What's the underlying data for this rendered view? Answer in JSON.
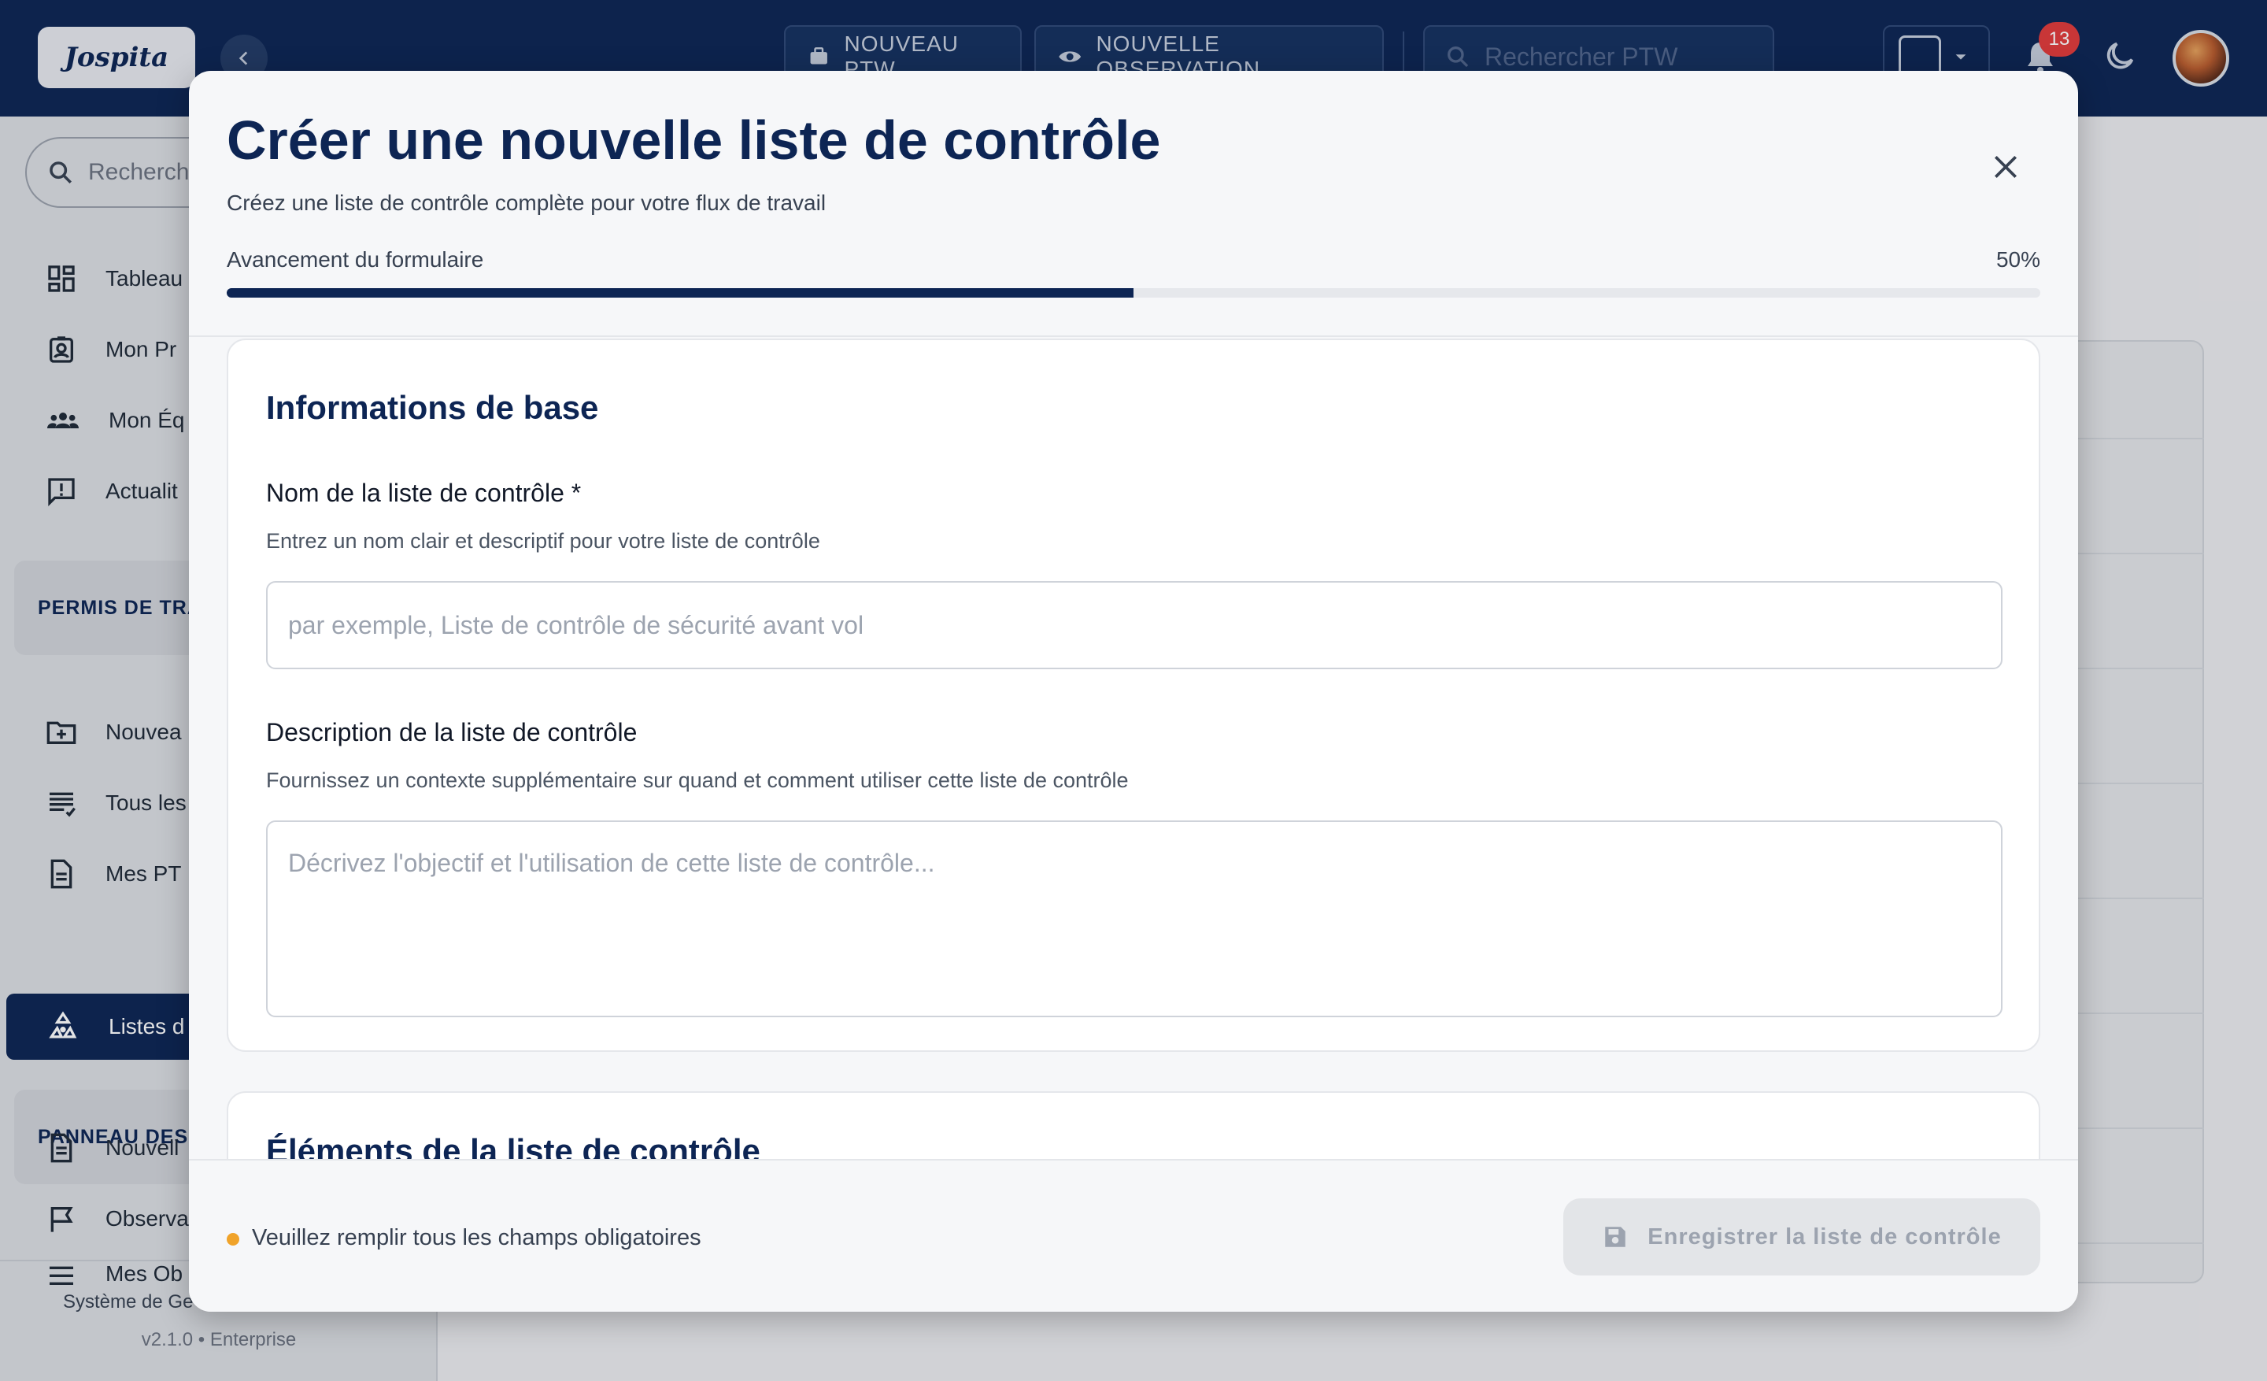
{
  "app": {
    "logo_text": "Jospita"
  },
  "topbar": {
    "new_ptw": "NOUVEAU PTW",
    "new_observation": "NOUVELLE OBSERVATION",
    "search_placeholder": "Rechercher PTW",
    "notification_count": "13"
  },
  "sidebar": {
    "search_placeholder": "Recherch",
    "items_top": [
      {
        "label": "Tableau",
        "icon": "dashboard-icon"
      },
      {
        "label": "Mon Pr",
        "icon": "profile-badge-icon"
      },
      {
        "label": "Mon Éq",
        "icon": "team-icon"
      },
      {
        "label": "Actualit",
        "icon": "announcement-icon"
      }
    ],
    "section_permits": "PERMIS DE TRA",
    "items_permits": [
      {
        "label": "Nouvea",
        "icon": "folder-plus-icon"
      },
      {
        "label": "Tous les",
        "icon": "list-icon"
      },
      {
        "label": "Mes PT",
        "icon": "document-icon"
      },
      {
        "label": "Listes d",
        "icon": "recycle-icon",
        "active": true
      }
    ],
    "section_panel": "PANNEAU DES",
    "items_panel": [
      {
        "label": "Nouvell",
        "icon": "document-icon"
      },
      {
        "label": "Observa",
        "icon": "flag-icon"
      },
      {
        "label": "Mes Ob",
        "icon": "menu-icon"
      }
    ],
    "footer_line1": "Système de Ge",
    "footer_line2": "v2.1.0 • Enterprise"
  },
  "modal": {
    "title": "Créer une nouvelle liste de contrôle",
    "subtitle": "Créez une liste de contrôle complète pour votre flux de travail",
    "progress_label": "Avancement du formulaire",
    "progress_text": "50%",
    "progress_value": 0.5,
    "section_basic": "Informations de base",
    "name_label": "Nom de la liste de contrôle *",
    "name_help": "Entrez un nom clair et descriptif pour votre liste de contrôle",
    "name_placeholder": "par exemple, Liste de contrôle de sécurité avant vol",
    "name_value": "",
    "desc_label": "Description de la liste de contrôle",
    "desc_help": "Fournissez un contexte supplémentaire sur quand et comment utiliser cette liste de contrôle",
    "desc_placeholder": "Décrivez l'objectif et l'utilisation de cette liste de contrôle...",
    "desc_value": "",
    "section_items": "Éléments de la liste de contrôle",
    "warning": "Veuillez remplir tous les champs obligatoires",
    "save_label": "Enregistrer la liste de contrôle"
  },
  "colors": {
    "navy": "#0d2554",
    "warning": "#f0a32a",
    "badge": "#e23b3b"
  }
}
